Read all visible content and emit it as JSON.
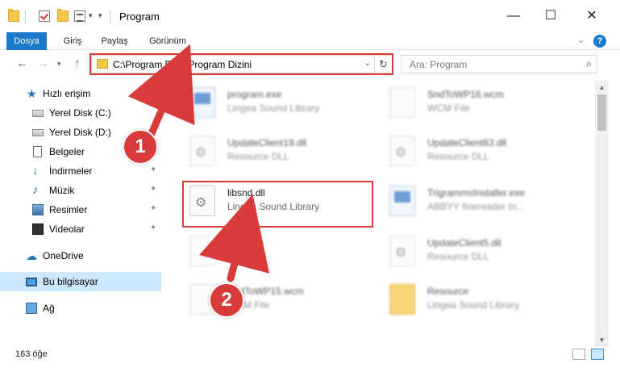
{
  "window": {
    "title": "Program",
    "minimize": "—",
    "maximize": "☐",
    "close": "✕"
  },
  "ribbon": {
    "tabs": [
      "Dosya",
      "Giriş",
      "Paylaş",
      "Görünüm"
    ],
    "expand": "⌄",
    "help": "?"
  },
  "address_bar": {
    "path": "C:\\Program Files\\Program Dizini",
    "search_placeholder": "Ara: Program"
  },
  "sidebar": {
    "items": [
      {
        "label": "Hızlı erişim",
        "icon": "star-icon"
      },
      {
        "label": "Yerel Disk (C:)",
        "icon": "drive-icon"
      },
      {
        "label": "Yerel Disk (D:)",
        "icon": "drive-icon"
      },
      {
        "label": "Belgeler",
        "icon": "document-icon"
      },
      {
        "label": "İndirmeler",
        "icon": "download-icon"
      },
      {
        "label": "Müzik",
        "icon": "music-icon"
      },
      {
        "label": "Resimler",
        "icon": "pictures-icon"
      },
      {
        "label": "Videolar",
        "icon": "video-icon"
      },
      {
        "label": "OneDrive",
        "icon": "cloud-icon"
      },
      {
        "label": "Bu bilgisayar",
        "icon": "computer-icon"
      },
      {
        "label": "Ağ",
        "icon": "network-icon"
      }
    ],
    "pin_glyph": "📌"
  },
  "files": [
    {
      "name": "program.exe",
      "desc": "Lingea Sound Library",
      "type": "exe"
    },
    {
      "name": "SndToWP16.wcm",
      "desc": "WCM File",
      "type": "file"
    },
    {
      "name": "UpdateClient19.dll",
      "desc": "Resource DLL",
      "type": "dll"
    },
    {
      "name": "UpdateClient63.dll",
      "desc": "Resource DLL",
      "type": "dll"
    },
    {
      "name": "libsnd.dll",
      "desc": "Lingea Sound Library",
      "type": "dll"
    },
    {
      "name": "TrigrammsInstaller.exe",
      "desc": "ABBYY finereader tri...",
      "type": "exe"
    },
    {
      "name": "d...k",
      "desc": "C...file",
      "type": "file"
    },
    {
      "name": "UpdateClient5.dll",
      "desc": "Resource DLL",
      "type": "dll"
    },
    {
      "name": "SndToWP15.wcm",
      "desc": "WCM File",
      "type": "file"
    },
    {
      "name": "Resource",
      "desc": "Lingea Sound Library",
      "type": "folder"
    }
  ],
  "status": {
    "count": "163 öğe"
  },
  "callouts": [
    "1",
    "2"
  ],
  "colors": {
    "accent": "#1979ca",
    "highlight": "#d93a3a",
    "selected": "#cce8ff"
  }
}
